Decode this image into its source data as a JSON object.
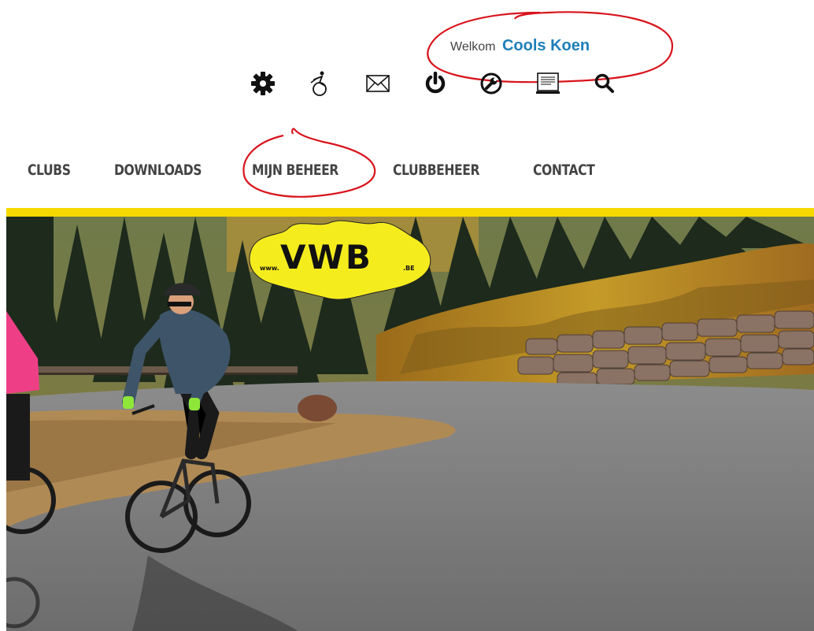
{
  "header": {
    "welcome_prefix": "Welkom",
    "user_name": "Cools Koen"
  },
  "toolbar": {
    "icons": [
      "gear-icon",
      "cyclist-icon",
      "mail-icon",
      "power-icon",
      "wrench-icon",
      "document-icon",
      "search-icon"
    ]
  },
  "nav": {
    "items": [
      {
        "label": "CLUBS"
      },
      {
        "label": "DOWNLOADS"
      },
      {
        "label": "MIJN BEHEER"
      },
      {
        "label": "CLUBBEHEER"
      },
      {
        "label": "CONTACT"
      }
    ]
  },
  "hero": {
    "logo_prefix": "www.",
    "logo_main": "VWB",
    "logo_suffix": ".BE"
  },
  "colors": {
    "accent_yellow": "#f5d900",
    "user_name_blue": "#1f7fb8",
    "annotation_red": "#d8141c",
    "nav_text": "#444444"
  }
}
